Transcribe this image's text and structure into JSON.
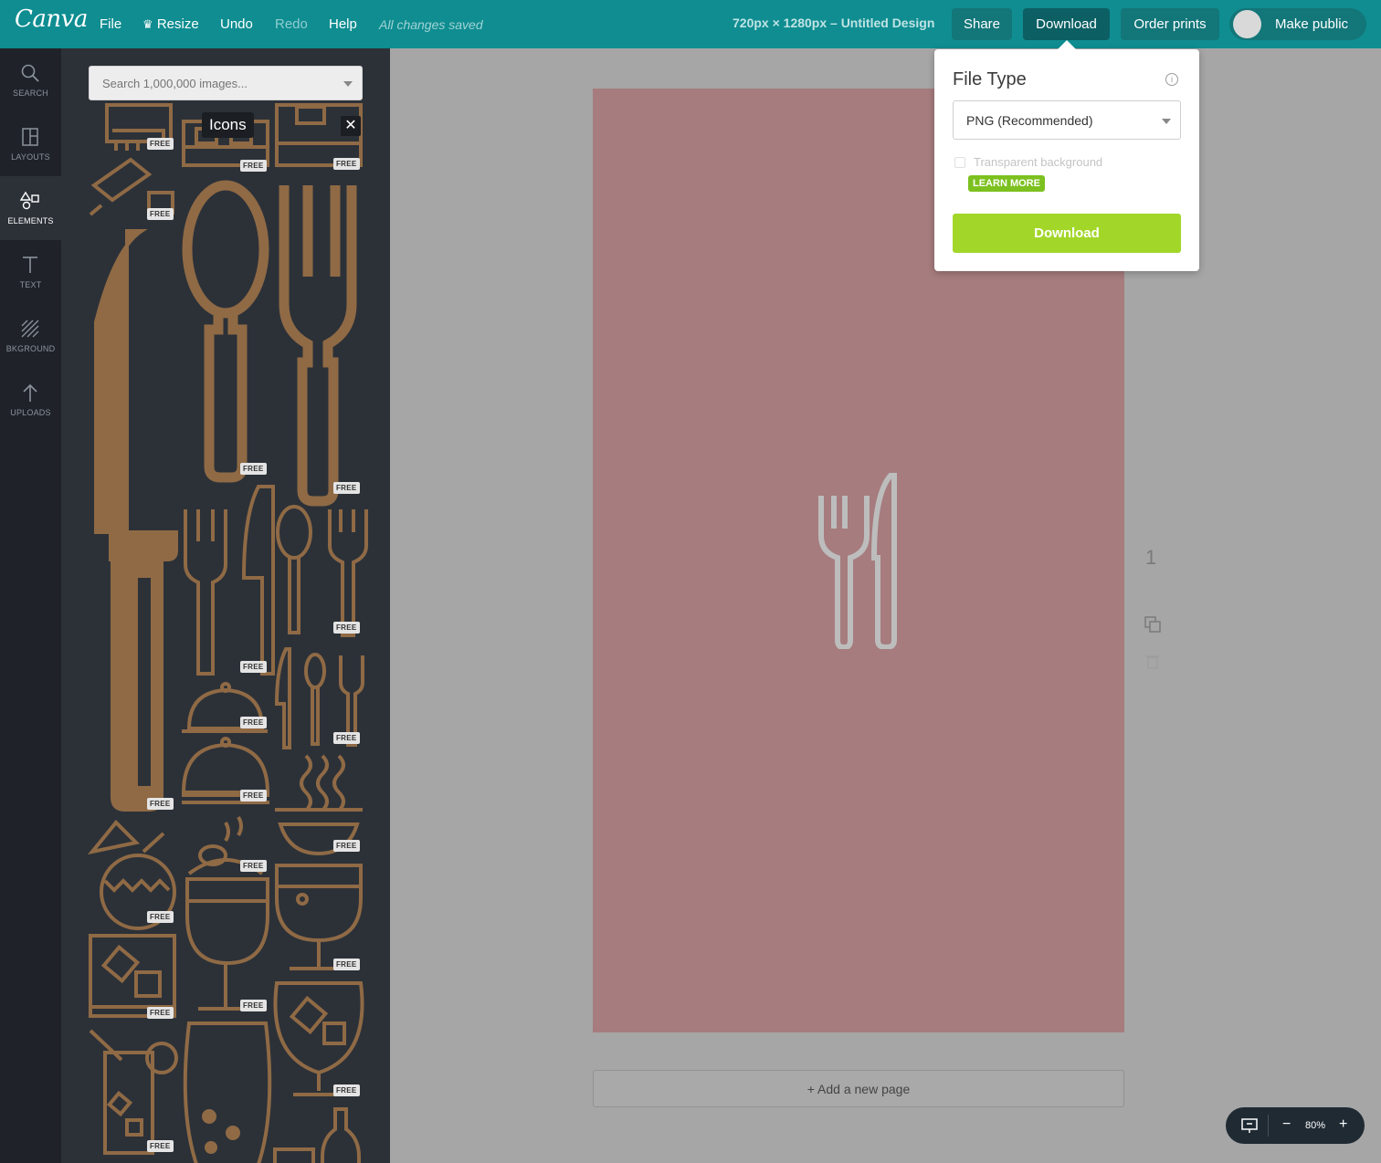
{
  "app": {
    "logo": "Canva"
  },
  "topbar": {
    "menu": {
      "file": "File",
      "resize": "Resize",
      "undo": "Undo",
      "redo": "Redo",
      "help": "Help"
    },
    "save_status": "All changes saved",
    "doc_title": "720px × 1280px – Untitled Design",
    "share": "Share",
    "download": "Download",
    "order_prints": "Order prints",
    "make_public": "Make public"
  },
  "rail": {
    "search": "SEARCH",
    "layouts": "LAYOUTS",
    "elements": "ELEMENTS",
    "text": "TEXT",
    "background": "BKGROUND",
    "uploads": "UPLOADS"
  },
  "panel": {
    "search_placeholder": "Search 1,000,000 images...",
    "tooltip": "Icons",
    "close": "✕",
    "free_badge": "FREE"
  },
  "popover": {
    "title": "File Type",
    "info": "i",
    "file_type_value": "PNG (Recommended)",
    "transparent_label": "Transparent background",
    "learn_more": "LEARN MORE",
    "download_button": "Download"
  },
  "canvas": {
    "page_number": "1",
    "add_page": "+ Add a new page"
  },
  "zoom": {
    "minus": "−",
    "value": "80%",
    "plus": "+"
  },
  "colors": {
    "topbar": "#0f8d91",
    "icon_brown": "#8f6a45",
    "page": "#a67c7e",
    "download_green": "#a2d72a"
  }
}
